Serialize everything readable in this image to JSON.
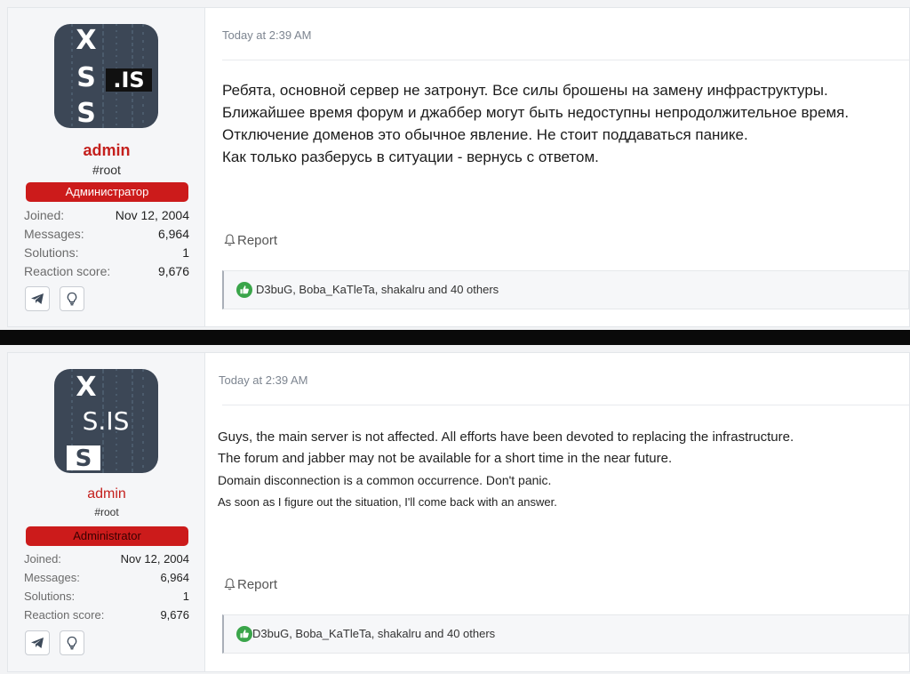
{
  "posts": [
    {
      "user": {
        "name": "admin",
        "title": "#root",
        "banner": "Администратор"
      },
      "avatar": {
        "top": "X",
        "mid": "S",
        "badge": ".IS",
        "bottom": "S"
      },
      "stats": [
        {
          "key": "Joined:",
          "value": "Nov 12, 2004"
        },
        {
          "key": "Messages:",
          "value": "6,964"
        },
        {
          "key": "Solutions:",
          "value": "1"
        },
        {
          "key": "Reaction score:",
          "value": "9,676"
        }
      ],
      "timestamp": "Today at 2:39 AM",
      "lines": [
        "Ребята, основной сервер не затронут. Все силы брошены на замену инфраструктуры.",
        "Ближайшее время форум и джаббер могут быть недоступны непродолжительное время.",
        "Отключение доменов это обычное явление. Не стоит поддаваться панике.",
        "Как только разберусь в ситуации - вернусь с ответом."
      ],
      "report": "Report",
      "reactions": "D3buG, Boba_KaTleTa, shakalru and 40 others"
    },
    {
      "user": {
        "name": "admin",
        "title": "#root",
        "banner": "Administrator"
      },
      "avatar": {
        "top": "X",
        "mid": "S.IS",
        "badge": "",
        "bottom": "S"
      },
      "stats": [
        {
          "key": "Joined:",
          "value": "Nov 12, 2004"
        },
        {
          "key": "Messages:",
          "value": "6,964"
        },
        {
          "key": "Solutions:",
          "value": "1"
        },
        {
          "key": "Reaction score:",
          "value": "9,676"
        }
      ],
      "timestamp": "Today at 2:39 AM",
      "lines": [
        "Guys, the main server is not affected. All efforts have been devoted to replacing the infrastructure.",
        "The forum and jabber may not be available for a short time in the near future.",
        "Domain disconnection is a common occurrence. Don't panic.",
        "As soon as I figure out the situation, I'll come back with an answer."
      ],
      "report": "Report",
      "reactions": "D3buG, Boba_KaTleTa, shakalru and 40 others"
    }
  ],
  "icons": {
    "telegram": "telegram-icon",
    "lightbulb": "lightbulb-icon",
    "report": "bell-icon",
    "like": "thumbs-up-icon"
  },
  "colors": {
    "username": "#c4201d",
    "banner": "#cc1b1b",
    "like": "#3aa54a"
  }
}
